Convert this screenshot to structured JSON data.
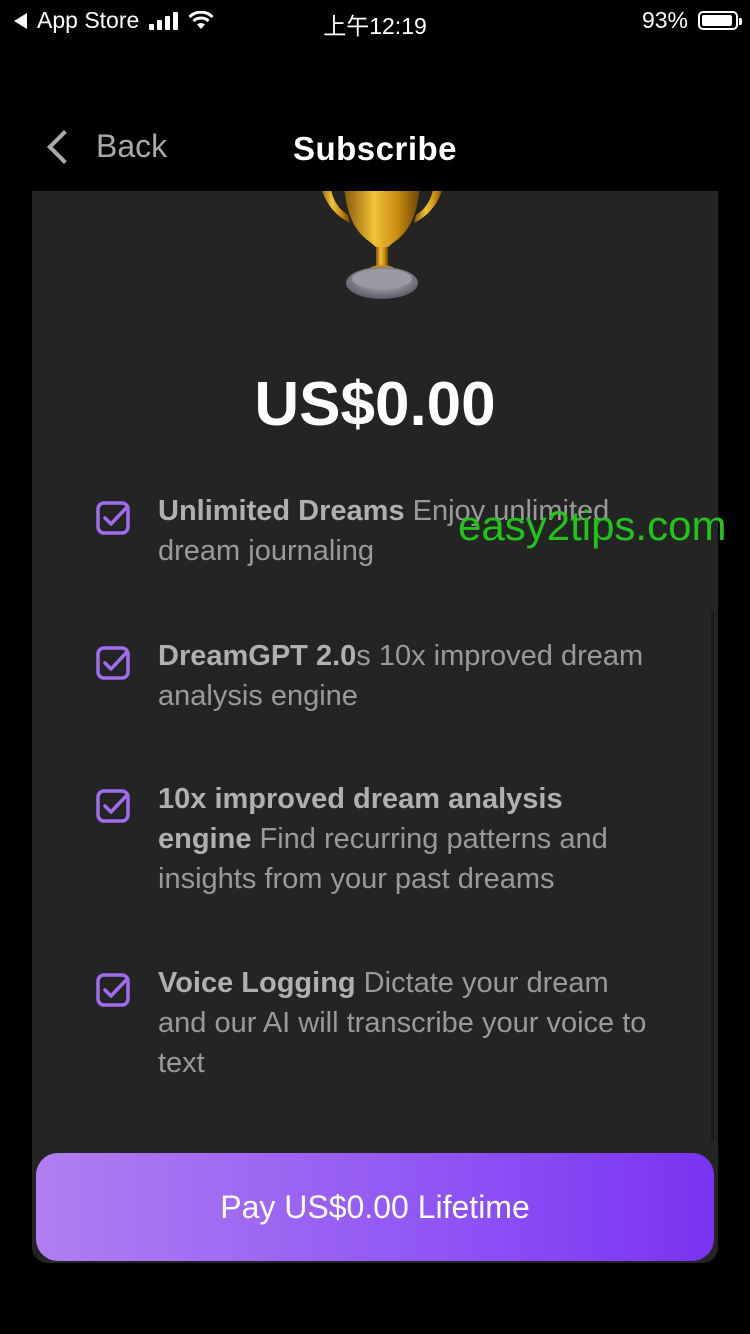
{
  "status_bar": {
    "back_app": "App Store",
    "time": "上午12:19",
    "battery": "93%",
    "battery_level": 0.93
  },
  "nav": {
    "back_label": "Back",
    "title": "Subscribe"
  },
  "price": "US$0.00",
  "features": [
    {
      "bold": "Unlimited Dreams",
      "text": " Enjoy unlimited dream journaling"
    },
    {
      "bold": "DreamGPT 2.0",
      "text": "s 10x improved dream analysis engine"
    },
    {
      "bold": "10x improved dream analysis engine",
      "text": " Find recurring patterns and insights from your past dreams"
    },
    {
      "bold": "Voice Logging",
      "text": " Dictate your dream and our AI will transcribe your voice to text"
    }
  ],
  "pay_button": "Pay US$0.00 Lifetime",
  "watermark": "easy2tips.com",
  "colors": {
    "accent": "#8a4df3",
    "check": "#a06cf0",
    "card": "#242424",
    "watermark": "#22c41c"
  },
  "icons": [
    "back-triangle-icon",
    "signal-icon",
    "wifi-icon",
    "battery-icon",
    "chevron-left-icon",
    "trophy-icon",
    "checkbox-checked-icon"
  ]
}
